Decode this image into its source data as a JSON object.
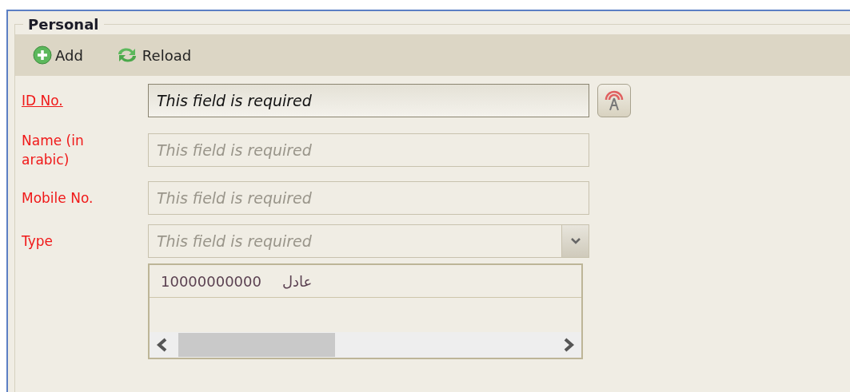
{
  "panel": {
    "title": "Personal"
  },
  "toolbar": [
    {
      "label": "Add",
      "kind": "add"
    },
    {
      "label": "Reload",
      "kind": "reload"
    }
  ],
  "fields": [
    {
      "label": "ID No.",
      "kind": "text",
      "underlined": true,
      "value": "This field is required",
      "lookup_button": true
    },
    {
      "label": "Name (in arabic)",
      "kind": "text",
      "underlined": false,
      "placeholder": "This field is required",
      "lookup_button": false
    },
    {
      "label": "Mobile No.",
      "kind": "text",
      "underlined": false,
      "placeholder": "This field is required",
      "lookup_button": false
    },
    {
      "label": "Type",
      "kind": "combo",
      "underlined": false,
      "placeholder": "This field is required",
      "lookup_button": false
    }
  ],
  "list": {
    "rows": [
      {
        "cells": [
          "10000000000",
          "عادل"
        ]
      }
    ]
  }
}
